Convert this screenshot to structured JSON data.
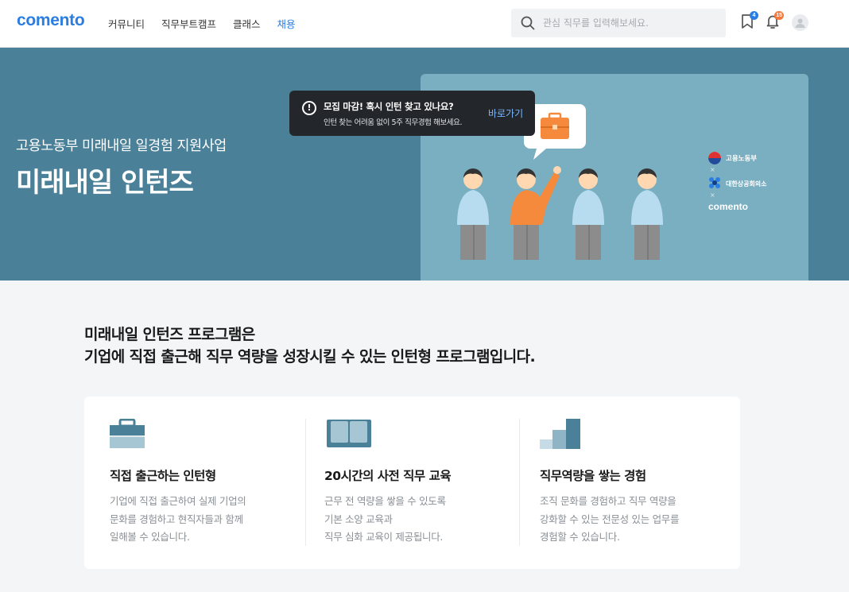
{
  "header": {
    "logo": "comento",
    "nav": [
      "커뮤니티",
      "직무부트캠프",
      "클래스",
      "채용"
    ],
    "active_nav": "채용",
    "search_placeholder": "관심 직무를 입력해보세요.",
    "bookmark_badge": "4",
    "notification_badge": "15"
  },
  "hero": {
    "subtitle": "고용노동부 미래내일 일경험 지원사업",
    "title": "미래내일 인턴즈",
    "partners": [
      "고용노동부",
      "대한상공회의소",
      "comento"
    ],
    "partner_separator": "×"
  },
  "tooltip": {
    "headline": "모집 마감! 혹시 인턴 찾고 있나요?",
    "detail": "인턴 찾는 어려움 없이 5주 직무경험 해보세요.",
    "link": "바로가기"
  },
  "intro": {
    "line1": "미래내일 인턴즈 프로그램은",
    "line2": "기업에 직접 출근해 직무 역량을 성장시킬 수 있는 인턴형 프로그램입니다."
  },
  "features": [
    {
      "icon": "briefcase-icon",
      "title": "직접 출근하는 인턴형",
      "desc": [
        "기업에 직접 출근하여 실제 기업의",
        "문화를 경험하고 현직자들과 함께",
        "일해볼 수 있습니다."
      ]
    },
    {
      "icon": "book-icon",
      "title": "20시간의 사전 직무 교육",
      "desc": [
        "근무 전 역량을 쌓을 수 있도록",
        "기본 소양 교육과",
        "직무 심화 교육이 제공됩니다."
      ]
    },
    {
      "icon": "growth-bars-icon",
      "title": "직무역량을 쌓는 경험",
      "desc": [
        "조직 문화를 경험하고 직무 역량을",
        "강화할 수 있는 전문성 있는 업무를",
        "경험할 수 있습니다."
      ]
    }
  ],
  "colors": {
    "brand": "#2a7de1",
    "hero_bg": "#4a8098",
    "hero_card": "#7aaec1",
    "accent_orange": "#f58a3c"
  }
}
